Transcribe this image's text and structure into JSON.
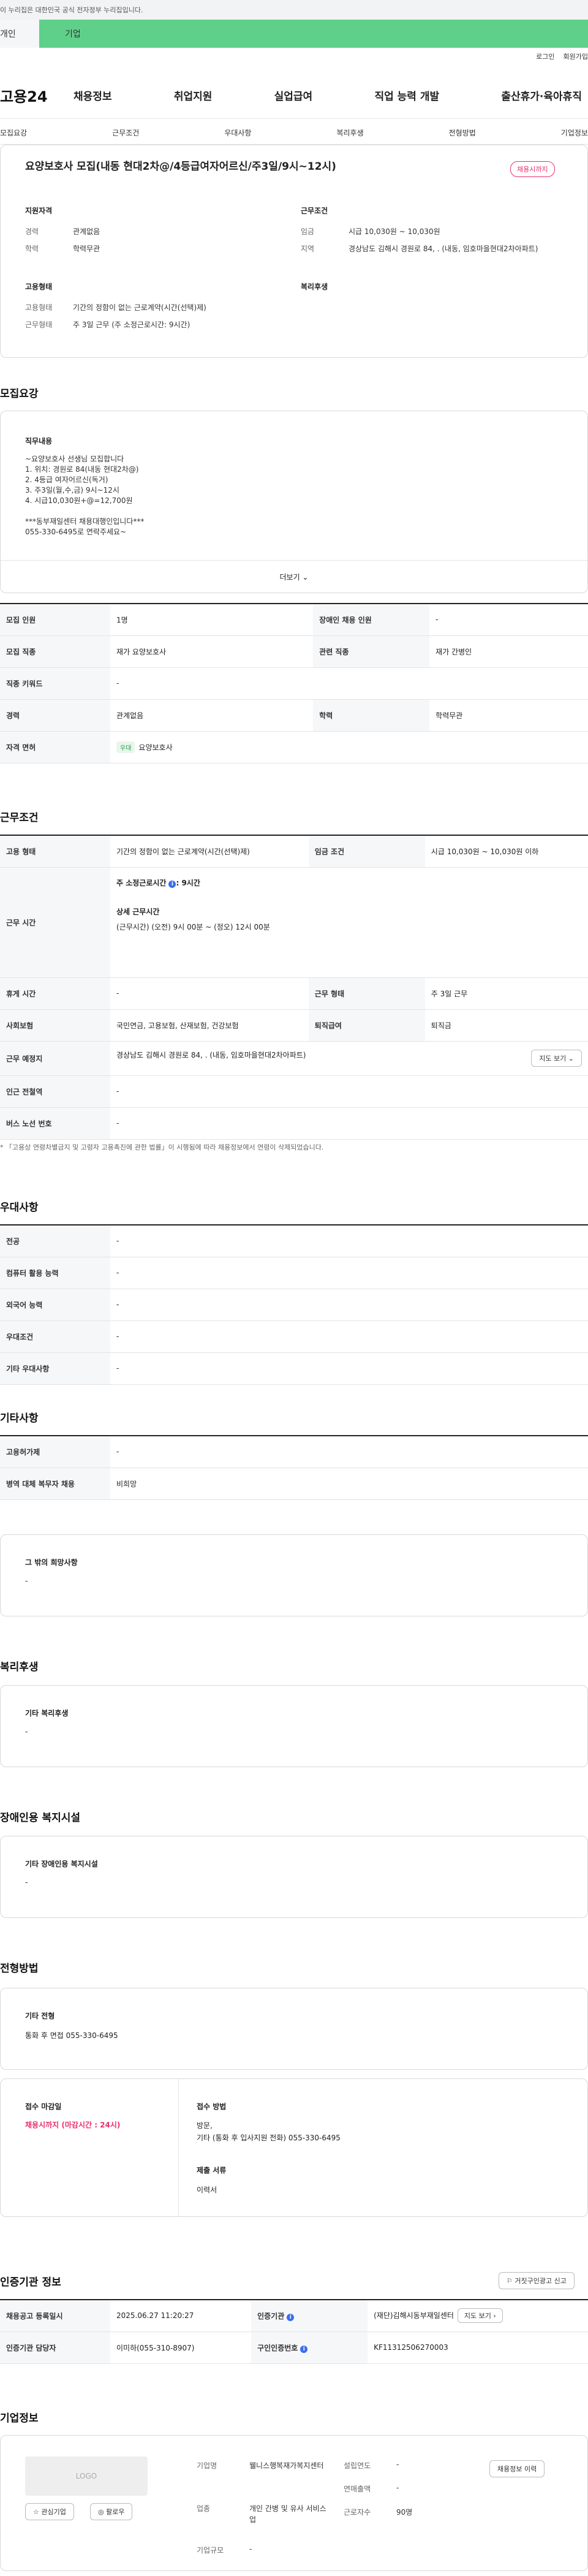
{
  "gov_banner": "이 누리집은 대한민국 공식 전자정부 누리집입니다.",
  "gov_tabs": [
    "개인",
    "기업"
  ],
  "util": [
    "로그인",
    "회원가입"
  ],
  "logo": "고용24",
  "gnb": [
    "채용정보",
    "취업지원",
    "실업급여",
    "직업 능력 개발",
    "출산휴가·육아휴직"
  ],
  "subnav": [
    "모집요강",
    "근무조건",
    "우대사항",
    "복리후생",
    "전형방법",
    "기업정보"
  ],
  "job": {
    "title": "요양보호사 모집(내동 현대2차@/4등급여자어르신/주3일/9시~12시)",
    "badge": "채용시까지",
    "sections": {
      "qual": "지원자격",
      "cond": "근무조건",
      "type": "고용형태",
      "welfare": "복리후생"
    },
    "labels": {
      "career": "경력",
      "edu": "학력",
      "pay": "임금",
      "region": "지역",
      "emp": "고용형태",
      "work": "근무형태"
    },
    "career": "관계없음",
    "edu": "학력무관",
    "pay": "시급 10,030원 ~ 10,030원",
    "region": "경상남도 김해시 경원로 84, . (내동, 임호마을현대2차아파트)",
    "emp": "기간의 정함이 없는 근로계약(시간(선택)제)",
    "work": "주 3일 근무 (주 소정근로시간: 9시간)"
  },
  "req": {
    "heading": "모집요강",
    "detail_title": "직무내용",
    "detail": [
      "~요양보호사 선생님 모집합니다",
      "1. 위치: 경원로 84(내동 현대2차@)",
      "2. 4등급 여자어르신(독거)",
      "3. 주3일(월,수,금) 9시~12시",
      "4. 시급10,030원+@=12,700원",
      "",
      "***동부재일센터 채용대행인입니다***",
      "055-330-6495로 연락주세요~"
    ],
    "more": "더보기",
    "rows": [
      [
        "모집 인원",
        "1명",
        "장애인 채용 인원",
        "-"
      ],
      [
        "모집 직종",
        "재가 요양보호사",
        "관련 직종",
        "재가 간병인"
      ],
      [
        "직종 키워드",
        "-"
      ],
      [
        "경력",
        "관계없음",
        "학력",
        "학력무관"
      ],
      [
        "자격 면허",
        "요양보호사"
      ]
    ],
    "tag": "우대"
  },
  "cond": {
    "heading": "근무조건",
    "emp_label": "고용 형태",
    "emp": "기간의 정함이 없는 근로계약(시간(선택)제)",
    "wage_label": "임금 조건",
    "wage": "시급 10,030원 ~ 10,030원 이하",
    "time_label": "근무 시간",
    "week": "주 소정근로시간",
    "week_val": ": 9시간",
    "detail_title": "상세 근무시간",
    "detail": "(근무시간) (오전) 9시 00분 ~ (정오) 12시 00분",
    "rows": [
      [
        "휴게 시간",
        "-",
        "근무 형태",
        "주 3일 근무"
      ],
      [
        "사회보험",
        "국민연금, 고용보험, 산재보험, 건강보험",
        "퇴직급여",
        "퇴직금"
      ]
    ],
    "place_label": "근무 예정지",
    "place": "경상남도 김해시 경원로 84, . (내동, 임호마을현대2차아파트)",
    "map": "지도 보기",
    "subway": "인근 전철역",
    "bus": "버스 노선 번호",
    "dash": "-",
    "note": "* 「고용상 연령차별금지 및 고령자 고용촉진에 관한 법률」이 시행됨에 따라 채용정보에서 연령이 삭제되었습니다."
  },
  "pref": {
    "heading": "우대사항",
    "rows": [
      [
        "전공",
        "-"
      ],
      [
        "컴퓨터 활용 능력",
        "-"
      ],
      [
        "외국어 능력",
        "-"
      ],
      [
        "우대조건",
        "-"
      ],
      [
        "기타 우대사항",
        "-"
      ]
    ]
  },
  "etc": {
    "heading": "기타사항",
    "rows": [
      [
        "고용허가제",
        "-"
      ],
      [
        "병역 대체 복무자 채용",
        "비희망"
      ]
    ],
    "box_title": "그 밖의 희망사항",
    "box_val": "-"
  },
  "welfare": {
    "heading": "복리후생",
    "title": "기타 복리후생",
    "val": "-"
  },
  "disab": {
    "heading": "장애인용 복지시설",
    "title": "기타 장애인용 복지시설",
    "val": "-"
  },
  "process": {
    "heading": "전형방법",
    "title": "기타 전형",
    "val": "통화 후 면접 055-330-6495",
    "deadline_label": "접수 마감일",
    "deadline": "채용시까지 (마감시간 : 24시)",
    "method_label": "접수 방법",
    "method": [
      "방문,",
      "기타 (통화 후 입사지원 전화) 055-330-6495"
    ],
    "docs_label": "제출 서류",
    "docs": "이력서"
  },
  "cert": {
    "heading": "인증기관 정보",
    "report": "거짓구인광고 신고",
    "rows": [
      [
        "채용공고 등록일시",
        "2025.06.27 11:20:27",
        "인증기관",
        "(재단)김해시동부재일센터"
      ],
      [
        "인증기관 담당자",
        "이미하(055-310-8907)",
        "구인인증번호",
        "KF11312506270003"
      ]
    ],
    "map": "지도 보기"
  },
  "company": {
    "heading": "기업정보",
    "logo": "LOGO",
    "fav": "관심기업",
    "follow": "팔로우",
    "name_label": "기업명",
    "name": "웰니스행복재가복지센터",
    "year_label": "설립연도",
    "year": "-",
    "sales_label": "연매출액",
    "sales": "-",
    "ind_label": "업종",
    "ind": "개인 간병 및 유사 서비스업",
    "emp_label": "근로자수",
    "emp": "90명",
    "size_label": "기업규모",
    "size": "-",
    "info_btn": "채용정보 이력"
  }
}
